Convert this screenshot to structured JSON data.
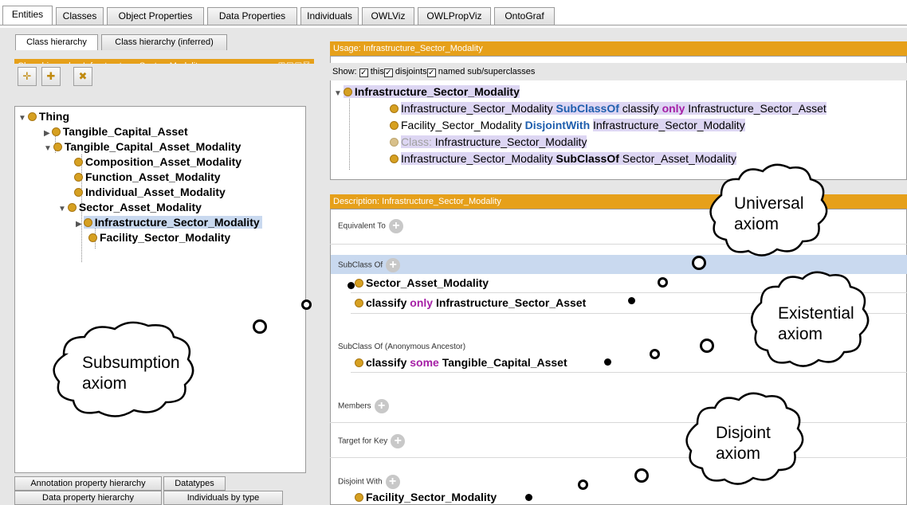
{
  "tabs": [
    "Entities",
    "Classes",
    "Object Properties",
    "Data Properties",
    "Individuals",
    "OWLViz",
    "OWLPropViz",
    "OntoGraf"
  ],
  "left": {
    "subtabs": [
      "Class hierarchy",
      "Class hierarchy (inferred)"
    ],
    "header": "Class hierarchy: Infrastructure_Sector_Modality",
    "tree": {
      "thing": "Thing",
      "tca": "Tangible_Capital_Asset",
      "tcam": "Tangible_Capital_Asset_Modality",
      "cam": "Composition_Asset_Modality",
      "fam": "Function_Asset_Modality",
      "iam": "Individual_Asset_Modality",
      "sam": "Sector_Asset_Modality",
      "ism": "Infrastructure_Sector_Modality",
      "fsm": "Facility_Sector_Modality"
    },
    "bottom_tabs": [
      "Annotation property hierarchy",
      "Datatypes",
      "Data property hierarchy",
      "Individuals by type"
    ]
  },
  "usage": {
    "header": "Usage: Infrastructure_Sector_Modality",
    "show_label": "Show:",
    "cb_this": "this",
    "cb_disjoints": "disjoints",
    "cb_named": "named sub/superclasses",
    "root": "Infrastructure_Sector_Modality",
    "r1a": "Infrastructure_Sector_Modality",
    "r1b": "SubClassOf",
    "r1c": "classify",
    "r1d": "only",
    "r1e": "Infrastructure_Sector_Asset",
    "r2a": "Facility_Sector_Modality",
    "r2b": "DisjointWith",
    "r2c": "Infrastructure_Sector_Modality",
    "r3a": "Class:",
    "r3b": "Infrastructure_Sector_Modality",
    "r4a": "Infrastructure_Sector_Modality",
    "r4b": "SubClassOf",
    "r4c": "Sector_Asset_Modality"
  },
  "description": {
    "header": "Description: Infrastructure_Sector_Modality",
    "equivalent_to": "Equivalent To",
    "subclass_of": "SubClass Of",
    "sc1": "Sector_Asset_Modality",
    "sc2a": "classify",
    "sc2b": "only",
    "sc2c": "Infrastructure_Sector_Asset",
    "anon": "SubClass Of (Anonymous Ancestor)",
    "an1a": "classify",
    "an1b": "some",
    "an1c": "Tangible_Capital_Asset",
    "members": "Members",
    "target_for_key": "Target for Key",
    "disjoint_with": "Disjoint With",
    "dj1": "Facility_Sector_Modality"
  },
  "callouts": {
    "universal": [
      "Universal",
      "axiom"
    ],
    "existential": [
      "Existential",
      "axiom"
    ],
    "subsumption": [
      "Subsumption",
      "axiom"
    ],
    "disjoint": [
      "Disjoint",
      "axiom"
    ]
  },
  "colors": {
    "header_orange": "#e6a01a",
    "class_dot": "#d6a021",
    "keyword_blue": "#1f5fae",
    "keyword_purple": "#a51fa5",
    "selection": "#c9d9ef",
    "highlight": "#ddd6f3"
  },
  "icons": [
    "add-subclass-icon",
    "add-sibling-icon",
    "delete-class-icon",
    "class-dot-icon",
    "add-icon",
    "expand-triangle-icon",
    "collapse-triangle-icon",
    "checkbox-icon",
    "view-controls-icon"
  ]
}
